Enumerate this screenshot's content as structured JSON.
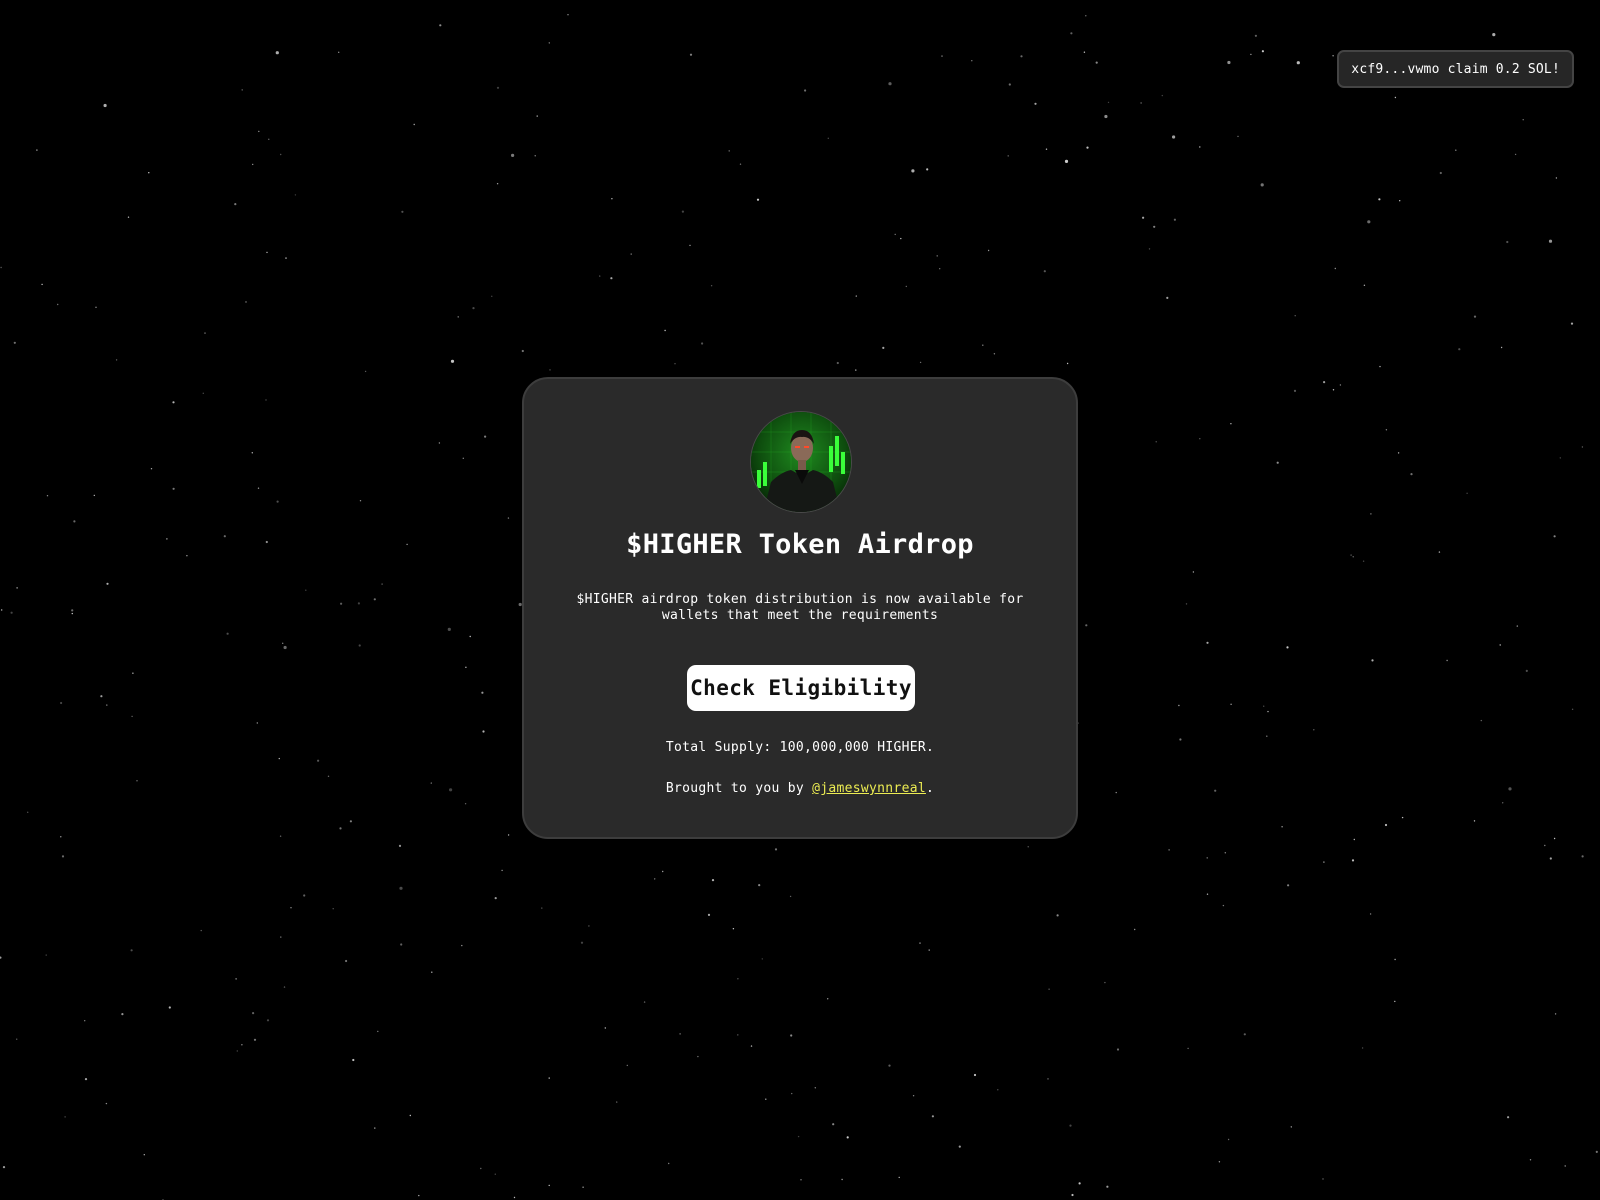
{
  "toast": {
    "text": "xcf9...vwmo claim 0.2 SOL!"
  },
  "card": {
    "avatar_icon": "trader-avatar-icon",
    "title": "$HIGHER Token Airdrop",
    "description": "$HIGHER airdrop token distribution is now available for wallets that meet the requirements",
    "button_label": "Check Eligibility",
    "supply_text": "Total Supply: 100,000,000 HIGHER.",
    "brought_prefix": "Brought to you by ",
    "author_handle": "@jameswynnreal",
    "brought_suffix": "."
  },
  "colors": {
    "background": "#000000",
    "card": "#2a2a2a",
    "link": "#ecec52",
    "button": "#ffffff",
    "avatar_accent": "#22e022"
  }
}
